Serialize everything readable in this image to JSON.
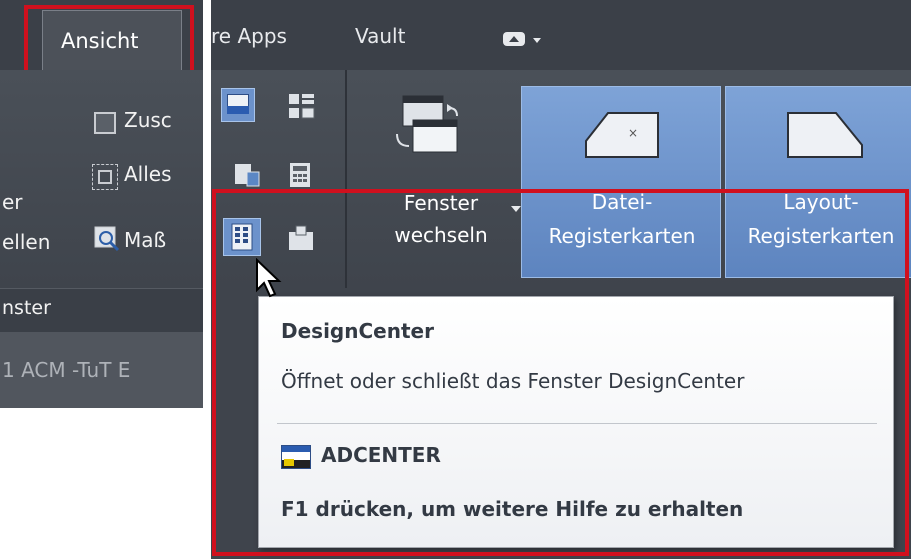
{
  "left_panel": {
    "tab_label": "Ansicht",
    "labels": {
      "zoom_cut": "Zusc",
      "all_cut": "Alles",
      "mass_cut": "Maß",
      "er_cut": "er",
      "ellen_cut": "ellen",
      "panel_title": "nster",
      "document_tab": "1 ACM -TuT E"
    }
  },
  "right_panel": {
    "tabs": {
      "apps_cut": "re Apps",
      "vault": "Vault"
    },
    "buttons": {
      "switch_windows": [
        "Fenster",
        "wechseln"
      ],
      "file_tabs": [
        "Datei-",
        "Registerkarten"
      ],
      "layout_tabs": [
        "Layout-",
        "Registerkarten"
      ]
    },
    "tooltip": {
      "title": "DesignCenter",
      "description": "Öffnet oder schließt das Fenster DesignCenter",
      "command": "ADCENTER",
      "help": "F1 drücken, um weitere Hilfe zu erhalten"
    }
  },
  "colors": {
    "highlight_border": "#d0101e",
    "active_button": "#5d84bf",
    "ribbon_background": "#43484f",
    "tooltip_text": "#333a44"
  }
}
